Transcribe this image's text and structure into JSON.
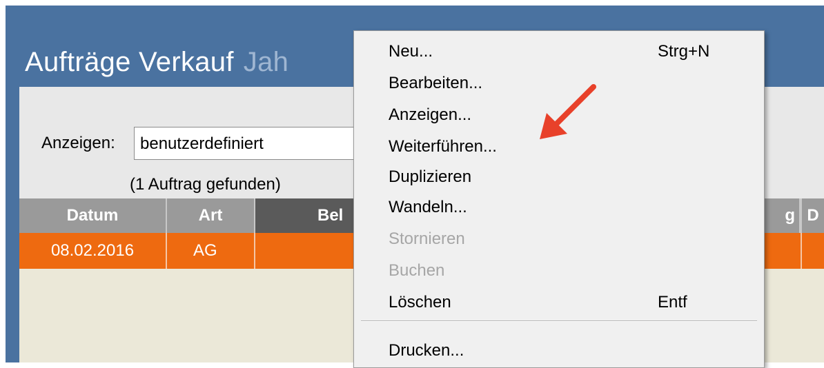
{
  "window": {
    "title": "Aufträge Verkauf",
    "subtitle": "Jah"
  },
  "filter": {
    "label": "Anzeigen:",
    "value": "benutzerdefiniert",
    "result": "(1 Auftrag gefunden)"
  },
  "table": {
    "columns": [
      "Datum",
      "Art",
      "Bel",
      "g",
      "D"
    ],
    "rows": [
      {
        "datum": "08.02.2016",
        "art": "AG"
      }
    ]
  },
  "context_menu": {
    "items": [
      {
        "label": "Neu...",
        "shortcut": "Strg+N",
        "enabled": true
      },
      {
        "label": "Bearbeiten...",
        "shortcut": "",
        "enabled": true
      },
      {
        "label": "Anzeigen...",
        "shortcut": "",
        "enabled": true
      },
      {
        "label": "Weiterführen...",
        "shortcut": "",
        "enabled": true
      },
      {
        "label": "Duplizieren",
        "shortcut": "",
        "enabled": true
      },
      {
        "label": "Wandeln...",
        "shortcut": "",
        "enabled": true
      },
      {
        "label": "Stornieren",
        "shortcut": "",
        "enabled": false
      },
      {
        "label": "Buchen",
        "shortcut": "",
        "enabled": false
      },
      {
        "label": "Löschen",
        "shortcut": "Entf",
        "enabled": true
      },
      {
        "label": "Drucken...",
        "shortcut": "",
        "enabled": true
      }
    ]
  },
  "annotation": {
    "icon": "red-arrow-icon",
    "color": "#e8412a"
  },
  "colors": {
    "header_bg": "#4a72a0",
    "selected_row": "#ee6a10",
    "table_header": "#9a9a9a"
  }
}
